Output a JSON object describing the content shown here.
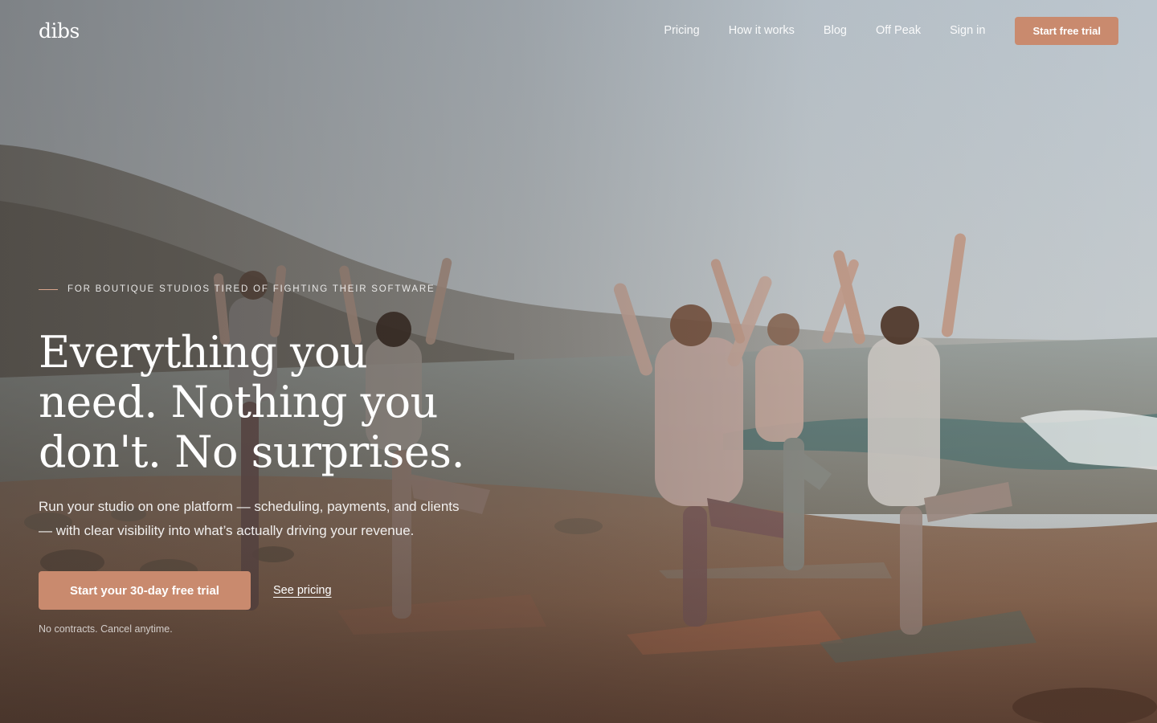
{
  "brand": {
    "logo_text": "dibs"
  },
  "nav": {
    "links": [
      "Pricing",
      "How it works",
      "Blog",
      "Off Peak",
      "Sign in"
    ],
    "cta_label": "Start free trial"
  },
  "hero": {
    "eyebrow": "FOR BOUTIQUE STUDIOS TIRED OF FIGHTING THEIR SOFTWARE",
    "headline": "Everything you need. Nothing you don't. No surprises.",
    "subhead": "Run your studio on one platform — scheduling, payments, and clients — with clear visibility into what’s actually driving your revenue.",
    "primary_cta": "Start your 30-day free trial",
    "secondary_cta": "See pricing",
    "fine_print": "No contracts. Cancel anytime.",
    "background": "beach-yoga-photo"
  },
  "colors": {
    "accent": "#c98a6e",
    "text_light": "#ffffff",
    "sky": "#c3ccd3",
    "sand": "#8a6a55",
    "sea": "#7f8b89"
  }
}
